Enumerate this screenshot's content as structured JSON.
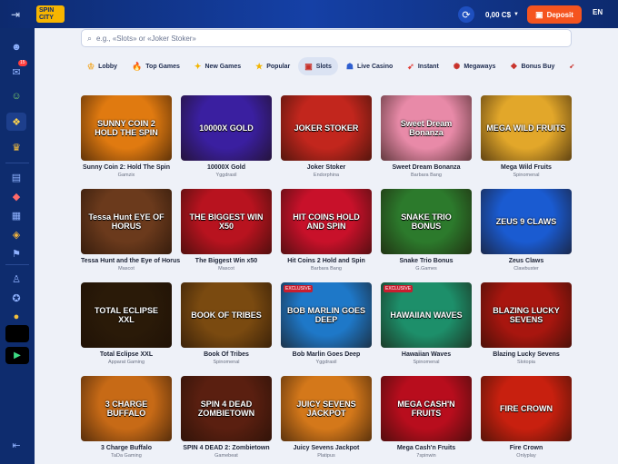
{
  "header": {
    "logo_text": "SPIN CITY",
    "balance": "0,00 C$",
    "deposit_label": "Deposit",
    "language": "EN"
  },
  "sidebar": {
    "notification_count": "15"
  },
  "search": {
    "placeholder": "e.g., «Slots» or «Joker Stoker»"
  },
  "categories": [
    {
      "label": "Lobby",
      "icon": "crown-icon"
    },
    {
      "label": "Top Games",
      "icon": "fire-icon"
    },
    {
      "label": "New Games",
      "icon": "sparkle-icon"
    },
    {
      "label": "Popular",
      "icon": "star-icon"
    },
    {
      "label": "Slots",
      "icon": "slot-machine-icon",
      "active": true
    },
    {
      "label": "Live Casino",
      "icon": "dealer-icon"
    },
    {
      "label": "Instant",
      "icon": "rocket-icon"
    },
    {
      "label": "Megaways",
      "icon": "megaways-icon"
    },
    {
      "label": "Bonus Buy",
      "icon": "gift-icon"
    }
  ],
  "games": [
    {
      "title": "Sunny Coin 2: Hold The Spin",
      "provider": "Gamzix",
      "thumb_text": "SUNNY COIN 2 HOLD THE SPIN"
    },
    {
      "title": "10000X Gold",
      "provider": "Yggdrasil",
      "thumb_text": "10000X GOLD"
    },
    {
      "title": "Joker Stoker",
      "provider": "Endorphina",
      "thumb_text": "JOKER STOKER"
    },
    {
      "title": "Sweet Dream Bonanza",
      "provider": "Barbara Bang",
      "thumb_text": "Sweet Dream Bonanza"
    },
    {
      "title": "Mega Wild Fruits",
      "provider": "Spinomenal",
      "thumb_text": "MEGA WILD FRUITS"
    },
    {
      "title": "Tessa Hunt and the Eye of Horus",
      "provider": "Mascot",
      "thumb_text": "Tessa Hunt EYE OF HORUS"
    },
    {
      "title": "The Biggest Win x50",
      "provider": "Mascot",
      "thumb_text": "THE BIGGEST WIN X50"
    },
    {
      "title": "Hit Coins 2 Hold and Spin",
      "provider": "Barbara Bang",
      "thumb_text": "HIT COINS HOLD AND SPIN"
    },
    {
      "title": "Snake Trio Bonus",
      "provider": "G.Games",
      "thumb_text": "SNAKE TRIO BONUS"
    },
    {
      "title": "Zeus Claws",
      "provider": "Clawbuster",
      "thumb_text": "ZEUS 9 CLAWS"
    },
    {
      "title": "Total Eclipse XXL",
      "provider": "Apparat Gaming",
      "thumb_text": "TOTAL ECLIPSE XXL"
    },
    {
      "title": "Book Of Tribes",
      "provider": "Spinomenal",
      "thumb_text": "BOOK OF TRIBES"
    },
    {
      "title": "Bob Marlin Goes Deep",
      "provider": "Yggdrasil",
      "thumb_text": "BOB MARLIN GOES DEEP",
      "tag": "EXCLUSIVE"
    },
    {
      "title": "Hawaiian Waves",
      "provider": "Spinomenal",
      "thumb_text": "HAWAIIAN WAVES",
      "tag": "EXCLUSIVE"
    },
    {
      "title": "Blazing Lucky Sevens",
      "provider": "Slotopia",
      "thumb_text": "BLAZING LUCKY SEVENS"
    },
    {
      "title": "3 Charge Buffalo",
      "provider": "TaDa Gaming",
      "thumb_text": "3 CHARGE BUFFALO"
    },
    {
      "title": "SPIN 4 DEAD 2: Zombietown",
      "provider": "Gamebeat",
      "thumb_text": "SPIN 4 DEAD ZOMBIETOWN"
    },
    {
      "title": "Juicy Sevens Jackpot",
      "provider": "Platipus",
      "thumb_text": "JUICY SEVENS JACKPOT"
    },
    {
      "title": "Mega Cash'n Fruits",
      "provider": "7spinwin",
      "thumb_text": "MEGA CASH'N FRUITS"
    },
    {
      "title": "Fire Crown",
      "provider": "Onlyplay",
      "thumb_text": "FIRE CROWN"
    }
  ],
  "thumb_colors": [
    "#e07a10",
    "#3a1fa0",
    "#c2261d",
    "#e88aa8",
    "#e2a72a",
    "#6b3a1c",
    "#b8131f",
    "#c8112a",
    "#2c7a2c",
    "#1a5bd1",
    "#2a1a08",
    "#7a4a10",
    "#1e78c8",
    "#1d8f6a",
    "#a8160f",
    "#c76a16",
    "#5a1f10",
    "#d4781a",
    "#b80d1d",
    "#c8200f"
  ]
}
